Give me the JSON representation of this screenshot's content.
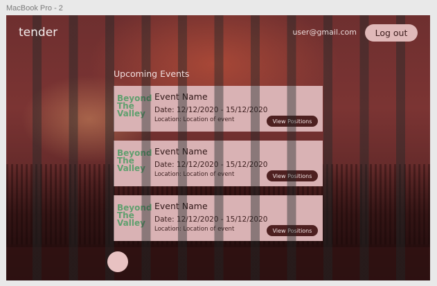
{
  "frame": {
    "label": "MacBook Pro - 2"
  },
  "header": {
    "brand": "tender",
    "user_email": "user@gmail.com",
    "logout_label": "Log out"
  },
  "main": {
    "section_title": "Upcoming Events",
    "events": [
      {
        "logo": [
          "Beyond",
          "The",
          "Valley"
        ],
        "name": "Event Name",
        "date": "Date: 12/12/2020 - 15/12/2020",
        "location": "Location: Location of event",
        "button_label": "View Positions"
      },
      {
        "logo": [
          "Beyond",
          "The",
          "Valley"
        ],
        "name": "Event Name",
        "date": "Date: 12/12/2020 - 15/12/2020",
        "location": "Location: Location of event",
        "button_label": "View Positions"
      },
      {
        "logo": [
          "Beyond",
          "The",
          "Valley"
        ],
        "name": "Event Name",
        "date": "Date: 12/12/2020 - 15/12/2020",
        "location": "Location: Location of event",
        "button_label": "View Positions"
      }
    ]
  },
  "colors": {
    "card_background": "#d9b2b4",
    "button_dark": "#4e2020",
    "logout_button": "#e0b9b9",
    "logo_green": "#5f9f6e"
  }
}
